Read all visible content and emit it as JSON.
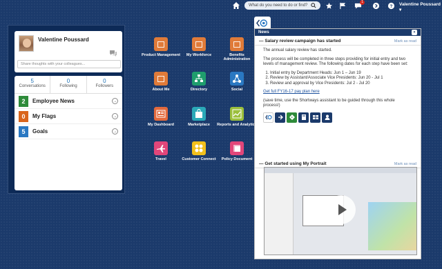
{
  "topbar": {
    "search_placeholder": "What do you need to do or find?",
    "notification_count": "1",
    "user_name": "Valentine Poussard"
  },
  "profile": {
    "name": "Valentine Poussard",
    "thoughts_placeholder": "Share thoughts with your colleagues...",
    "stats": [
      {
        "value": "5",
        "label": "Conversations"
      },
      {
        "value": "0",
        "label": "Following"
      },
      {
        "value": "0",
        "label": "Followers"
      }
    ],
    "feeds": [
      {
        "count": "2",
        "label": "Employee News",
        "color": "#2e8b3a"
      },
      {
        "count": "0",
        "label": "My Flags",
        "color": "#d9651c"
      },
      {
        "count": "5",
        "label": "Goals",
        "color": "#2a78c2"
      }
    ]
  },
  "apps": [
    {
      "label": "Product Management",
      "color": "#e07b39",
      "icon": "folder-icon"
    },
    {
      "label": "My Workforce",
      "color": "#e07b39",
      "icon": "folder-icon"
    },
    {
      "label": "Benefits Administration",
      "color": "#e07b39",
      "icon": "folder-icon"
    },
    {
      "label": "About Me",
      "color": "#e07b39",
      "icon": "folder-icon"
    },
    {
      "label": "Directory",
      "color": "#1f9e6d",
      "icon": "org-chart-icon"
    },
    {
      "label": "Social",
      "color": "#2a78c2",
      "icon": "network-icon"
    },
    {
      "label": "My Dashboard",
      "color": "#e36a3d",
      "icon": "dashboard-icon"
    },
    {
      "label": "Marketplace",
      "color": "#2aa9b8",
      "icon": "bag-icon"
    },
    {
      "label": "Reports and Analytics",
      "color": "#9bbf3c",
      "icon": "chart-icon"
    },
    {
      "label": "Travel",
      "color": "#e2467a",
      "icon": "plane-icon"
    },
    {
      "label": "Customer Connect",
      "color": "#f2c01c",
      "icon": "people-icon"
    },
    {
      "label": "Policy Document",
      "color": "#e2467a",
      "icon": "document-icon"
    }
  ],
  "news": {
    "header": "News",
    "mark_as_read": "Mark as read",
    "item1": {
      "title": "Salary review campaign has started",
      "p1": "The annual salary review has started.",
      "p2": "The process will be completed in three steps providing for initial entry and two levels of management review. The following dates for each step have been set:",
      "steps": [
        "Initial entry by Department Heads: Jun 1 –  Jun 19",
        "Review by Assistant/Associate Vice Presidents: Jun 20 - Jul 1",
        "Review and approval by Vice Presidents: Jul 2 - Jul 20"
      ],
      "link": "Get full FY16-17 pay plan here",
      "p3": "(save time, use the Shortways assistant to be guided through this whole process!)"
    },
    "item2": {
      "title": "Get started using My Portrait"
    }
  }
}
